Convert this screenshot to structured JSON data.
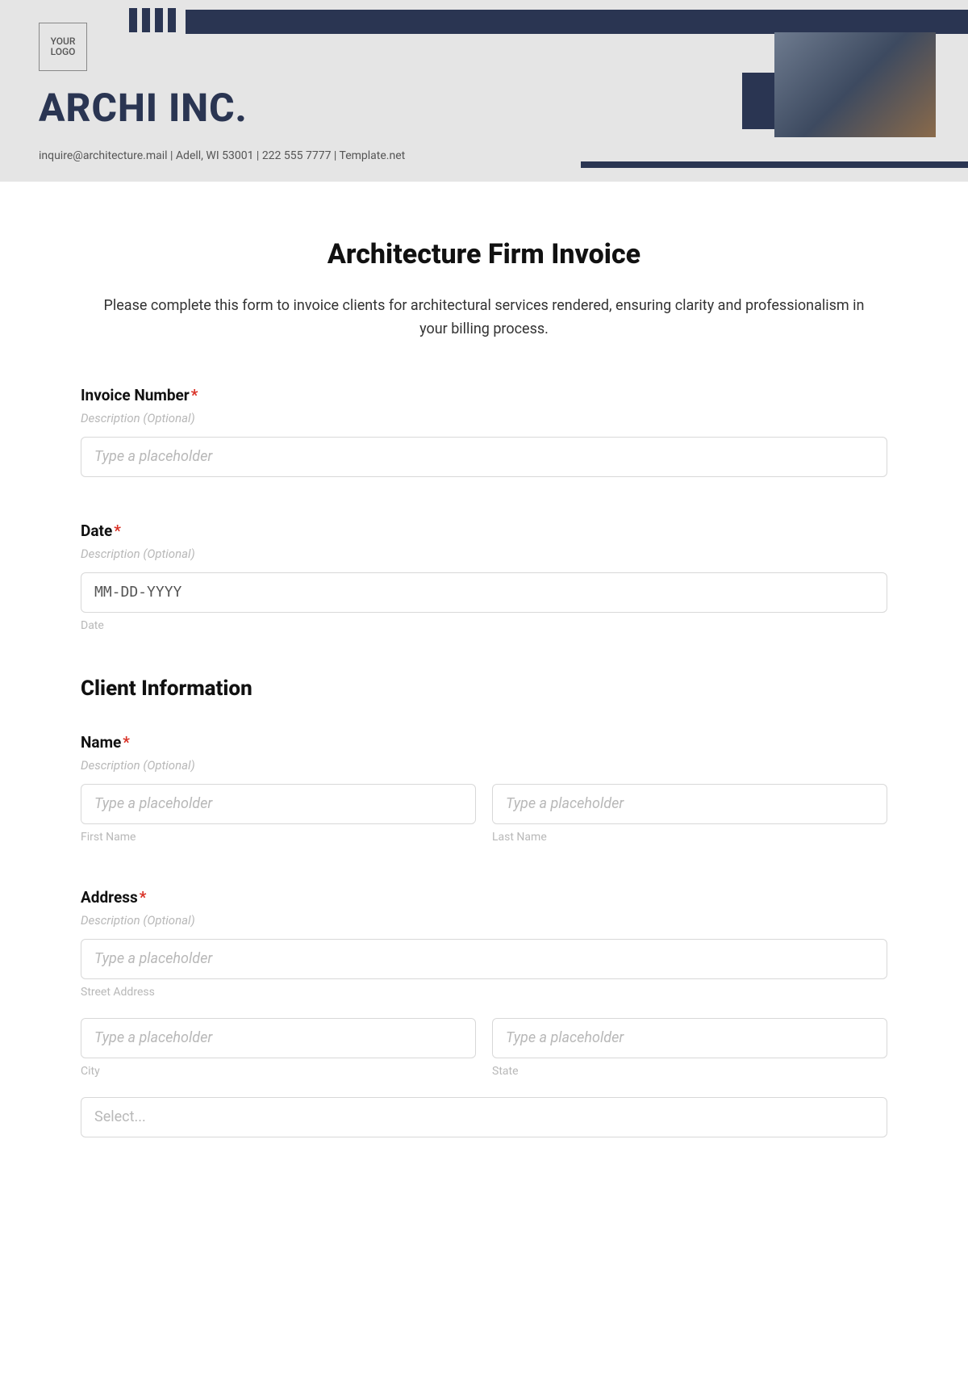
{
  "header": {
    "logo_placeholder": "YOUR LOGO",
    "company_name": "ARCHI INC.",
    "contact_line": "inquire@architecture.mail | Adell, WI 53001 | 222 555 7777 | Template.net"
  },
  "form": {
    "title": "Architecture Firm Invoice",
    "intro": "Please complete this form to invoice clients for architectural services rendered, ensuring clarity and professionalism in your billing process.",
    "invoice_number": {
      "label": "Invoice Number",
      "desc": "Description (Optional)",
      "placeholder": "Type a placeholder"
    },
    "date": {
      "label": "Date",
      "desc": "Description (Optional)",
      "placeholder": "MM-DD-YYYY",
      "sublabel": "Date"
    },
    "client_section": "Client Information",
    "name": {
      "label": "Name",
      "desc": "Description (Optional)",
      "first_placeholder": "Type a placeholder",
      "first_sublabel": "First Name",
      "last_placeholder": "Type a placeholder",
      "last_sublabel": "Last Name"
    },
    "address": {
      "label": "Address",
      "desc": "Description (Optional)",
      "street_placeholder": "Type a placeholder",
      "street_sublabel": "Street Address",
      "city_placeholder": "Type a placeholder",
      "city_sublabel": "City",
      "state_placeholder": "Type a placeholder",
      "state_sublabel": "State",
      "select_placeholder": "Select..."
    }
  }
}
